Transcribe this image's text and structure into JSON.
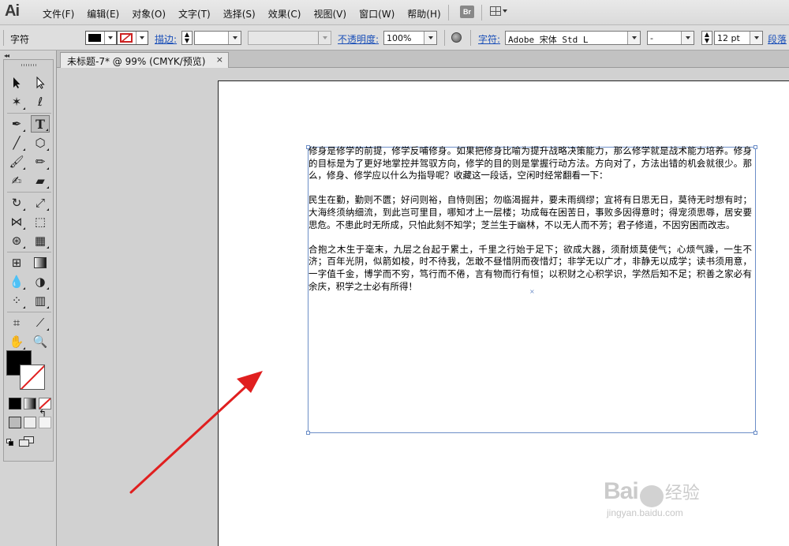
{
  "app": {
    "logo": "Ai",
    "bridge_badge": "Br"
  },
  "menu": [
    "文件(F)",
    "编辑(E)",
    "对象(O)",
    "文字(T)",
    "选择(S)",
    "效果(C)",
    "视图(V)",
    "窗口(W)",
    "帮助(H)"
  ],
  "control": {
    "panel_label": "字符",
    "stroke_label": "描边:",
    "opacity_label": "不透明度:",
    "opacity_value": "100%",
    "char_label": "字符:",
    "font_family": "Adobe 宋体 Std L",
    "font_style": "-",
    "font_size": "12 pt",
    "para_label": "段落"
  },
  "document": {
    "tab_title": "未标题-7* @ 99% (CMYK/预览)",
    "close_glyph": "×"
  },
  "text_frame": {
    "paragraphs": [
      "修身是修学的前提，修学反哺修身。如果把修身比喻为提升战略决策能力，那么修学就是战术能力培养。修身的目标是为了更好地掌控并驾驭方向，修学的目的则是掌握行动方法。方向对了，方法出错的机会就很少。那么，修身、修学应以什么为指导呢？收藏这一段话，空闲时经常翻看一下：",
      "民生在勤，勤则不匮；好问则裕，自恃则困；勿临渴掘井，要未雨绸缪；宜将有日思无日，莫待无时想有时；大海终须纳细流，到此岂可里目，哪知才上一层楼；功成每在困苦日，事败多因得意时；得宠须思辱，居安要思危。不患此时无所成，只怕此刻不知学；芝兰生于幽林，不以无人而不芳；君子修道，不因穷困而改志。",
      "合抱之木生于毫末，九层之台起于累土，千里之行始于足下；欲成大器，须耐烦莫使气；心烦气躁，一生不济；百年光阴，似箭如梭，时不待我，怎敢不昼惜阴而夜惜灯；非学无以广才，非静无以成学；读书须用意，一字值千金，博学而不穷，笃行而不倦，言有物而行有恒；以积财之心积学识，学然后知不足；积善之家必有余庆，积学之士必有所得！"
    ]
  },
  "watermark": {
    "brand_left": "Bai",
    "brand_right": "经验",
    "url": "jingyan.baidu.com"
  },
  "colors": {
    "arrow": "#e01f1f",
    "frame": "#6c8ec7",
    "link": "#1a4fb8"
  }
}
